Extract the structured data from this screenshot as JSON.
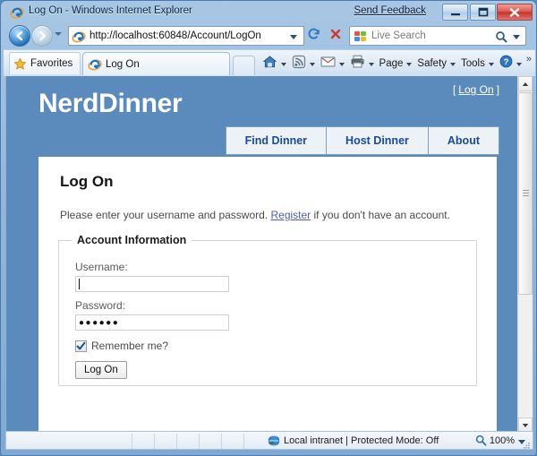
{
  "window": {
    "title": "Log On - Windows Internet Explorer",
    "send_feedback": "Send Feedback",
    "icon": "ie-logo-icon",
    "minimize_label": "–",
    "maximize_label": "□",
    "close_label": "✕"
  },
  "addressbar": {
    "back_glyph": "←",
    "forward_glyph": "→",
    "url": "http://localhost:60848/Account/LogOn",
    "refresh_icon": "refresh-icon",
    "stop_icon": "stop-icon",
    "search_placeholder": "Live Search",
    "search_go": "⌕"
  },
  "toolbar": {
    "favorites_label": "Favorites",
    "tab_label": "Log On",
    "commands": [
      {
        "label": "Page",
        "caret": true
      },
      {
        "label": "Safety",
        "caret": true
      },
      {
        "label": "Tools",
        "caret": true
      }
    ],
    "overflow_glyph": "»"
  },
  "page": {
    "site_title": "NerdDinner",
    "logon_bracket_open": "[",
    "logon_bracket_close": "]",
    "logon_link": "Log On",
    "nav_tabs": [
      {
        "label": "Find Dinner"
      },
      {
        "label": "Host Dinner"
      },
      {
        "label": "About"
      }
    ],
    "heading": "Log On",
    "intro_before": "Please enter your username and password.",
    "intro_link": "Register",
    "intro_after": "if you don't have an account.",
    "fieldset_legend": "Account Information",
    "username_label": "Username:",
    "username_value": "",
    "password_label": "Password:",
    "password_value": "●●●●●●",
    "remember_label": "Remember me?",
    "remember_checked": true,
    "submit_label": "Log On"
  },
  "statusbar": {
    "zone_text": "Local intranet | Protected Mode: Off",
    "zone_icon": "globe-icon",
    "zoom_level": "100%",
    "zoom_icon": "magnifier-icon"
  },
  "colors": {
    "page_blue": "#5b8bbc",
    "link_blue": "#1b4a9c",
    "register_link": "#4a5fb0",
    "chrome_blue": "#a8c7e4"
  }
}
